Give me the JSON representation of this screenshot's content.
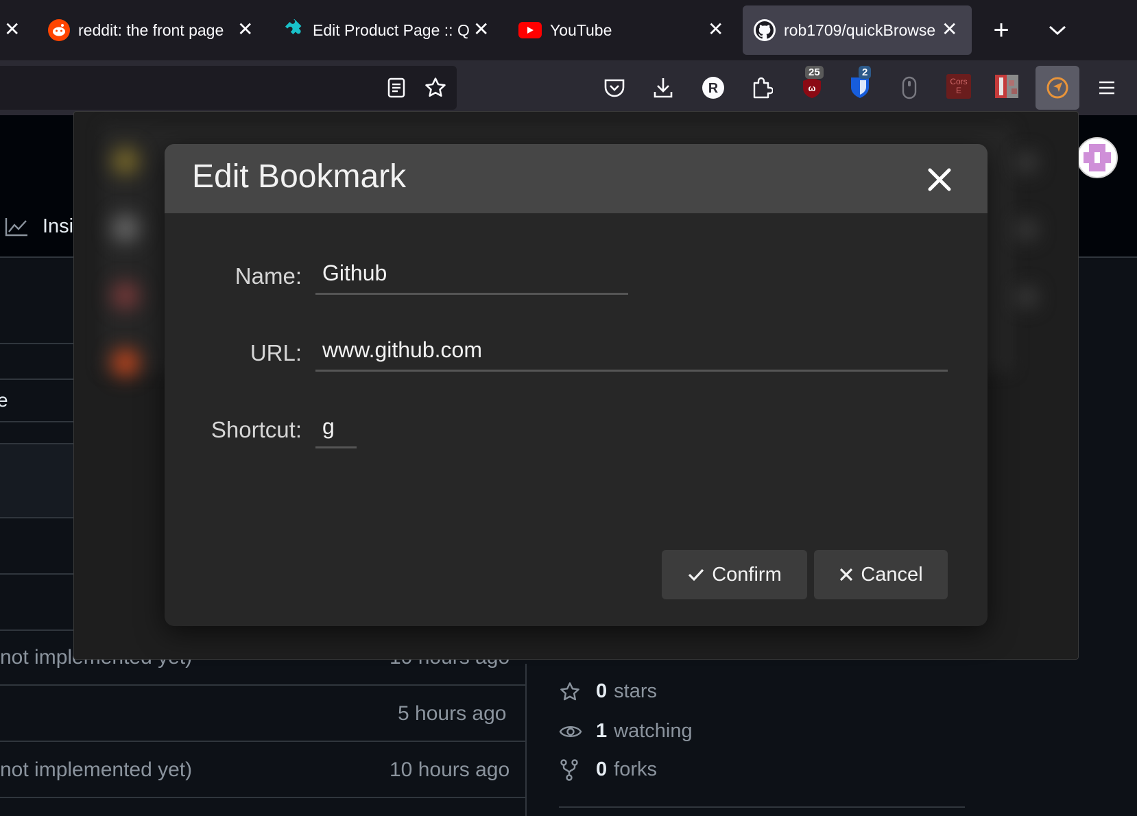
{
  "tabs": [
    {
      "label": "",
      "close": "✕"
    },
    {
      "label": "reddit: the front page",
      "close": "✕"
    },
    {
      "label": "Edit Product Page :: Q",
      "close": "✕"
    },
    {
      "label": "YouTube",
      "close": "✕"
    },
    {
      "label": "rob1709/quickBrowse",
      "close": "✕"
    }
  ],
  "toolbar": {
    "new_tab": "+",
    "badge_ublock": "25",
    "badge_bitwarden": "2",
    "cors_label": "Cors E"
  },
  "page": {
    "insights_label": "Insig",
    "left_fragment": "e",
    "commits": [
      {
        "message": "not implemented yet)",
        "time": "10 hours ago"
      },
      {
        "message": "",
        "time": "5 hours ago"
      },
      {
        "message": "not implemented yet)",
        "time": "10 hours ago"
      }
    ],
    "stats": {
      "stars_count": "0",
      "stars_label": "stars",
      "watching_count": "1",
      "watching_label": "watching",
      "forks_count": "0",
      "forks_label": "forks"
    }
  },
  "modal": {
    "title": "Edit Bookmark",
    "name_label": "Name:",
    "name_value": "Github",
    "url_label": "URL:",
    "url_value": "www.github.com",
    "shortcut_label": "Shortcut:",
    "shortcut_value": "g",
    "confirm_label": "Confirm",
    "cancel_label": "Cancel"
  },
  "colors": {
    "tabbar_bg": "#1c1b22",
    "toolbar_bg": "#2b2a33",
    "modal_bg": "#272727",
    "modal_header_bg": "#464646",
    "button_bg": "#3c3c3c",
    "reddit_orange": "#ff4500",
    "youtube_red": "#ff0000",
    "extension_orange": "#e8943a"
  }
}
